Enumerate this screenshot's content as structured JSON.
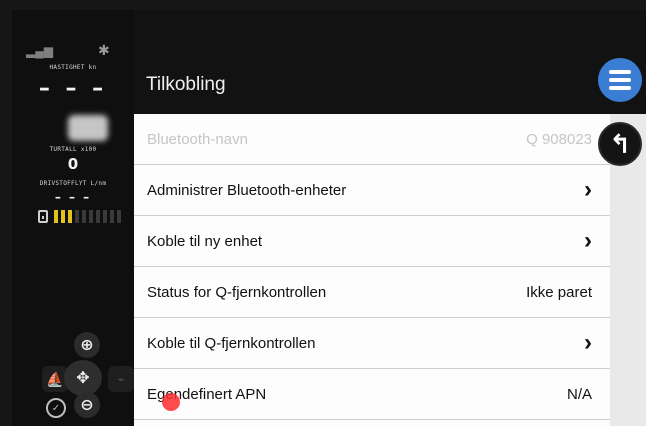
{
  "left_panel": {
    "speed_label": "HASTIGHET kn",
    "speed_value": "– – –",
    "rpm_label": "TURTALL x100",
    "rpm_value": "0",
    "fuel_label": "DRIVSTOFFLYT L/nm",
    "fuel_value": "– – –",
    "fuel_level_bars_on": 3,
    "fuel_level_bars_total": 10,
    "icons": [
      "signal-icon",
      "bluetooth-icon",
      "fuel-tank-icon",
      "zoom-in-icon",
      "zoom-out-icon",
      "pan-icon",
      "compass-icon"
    ]
  },
  "header": {
    "title": "Tilkobling"
  },
  "rows": [
    {
      "label": "Bluetooth-navn",
      "value": "Q 908023",
      "disabled": true
    },
    {
      "label": "Administrer Bluetooth-enheter",
      "chevron": "›"
    },
    {
      "label": "Koble til ny enhet",
      "chevron": "›"
    },
    {
      "label": "Status for Q-fjernkontrollen",
      "value": "Ikke paret"
    },
    {
      "label": "Koble til Q-fjernkontrollen",
      "chevron": "›"
    },
    {
      "label": "Egendefinert APN",
      "value": "N/A"
    }
  ],
  "colors": {
    "accent": "#3a7dd3",
    "fuel_bar_on": "#e3c21a",
    "touch_indicator": "#ff2b2b"
  }
}
